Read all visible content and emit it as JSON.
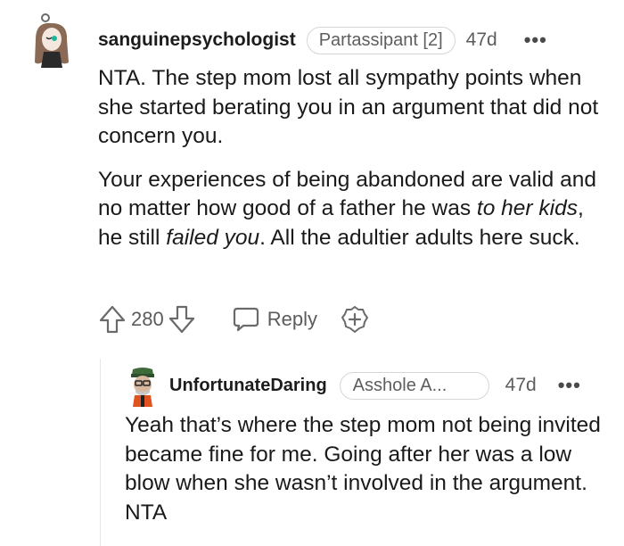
{
  "comments": [
    {
      "username": "sanguinepsychologist",
      "flair": "Partassipant [2]",
      "time": "47d",
      "more": "•••",
      "paragraphs": [
        {
          "text": "NTA. The step mom lost all sympathy points when she started berating you in an argument that did not concern you."
        },
        {
          "pre": "Your experiences of being abandoned are valid and no matter how good of a father he was ",
          "em1": "to her kids",
          "mid": ", he still ",
          "em2": "failed you",
          "post": ". All the adultier adults here suck."
        }
      ],
      "votes": "280",
      "reply_label": "Reply"
    },
    {
      "username": "UnfortunateDaring",
      "flair": "Asshole A...",
      "time": "47d",
      "more": "•••",
      "paragraphs": [
        {
          "text": "Yeah that’s where the step mom not being invited became fine for me. Going after her was a low blow when she wasn’t involved in the argument. NTA"
        }
      ]
    }
  ],
  "icons": {
    "upvote": "upvote-arrow-icon",
    "downvote": "downvote-arrow-icon",
    "reply": "speech-bubble-icon",
    "award": "award-plus-icon",
    "more": "more-options-icon"
  }
}
